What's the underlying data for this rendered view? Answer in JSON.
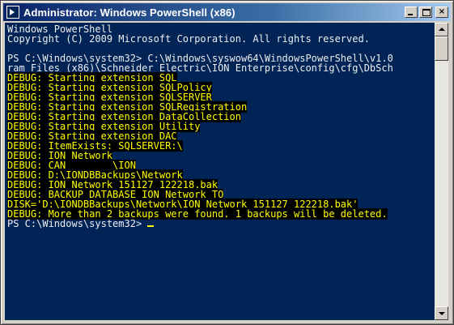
{
  "window": {
    "title": "Administrator: Windows PowerShell (x86)",
    "icon": "powershell-icon",
    "controls": {
      "minimize": "minimize-icon",
      "maximize": "maximize-icon",
      "close": "×"
    }
  },
  "console": {
    "background": "#012456",
    "lines": [
      "Windows PowerShell",
      "Copyright (C) 2009 Microsoft Corporation. All rights reserved.",
      "",
      "PS C:\\Windows\\system32> C:\\Windows\\syswow64\\WindowsPowerShell\\v1.0",
      "ram Files (x86)\\Schneider Electric\\ION Enterprise\\config\\cfg\\DbSch",
      "DEBUG: Starting extension SQL",
      "DEBUG: Starting extension SQLPolicy",
      "DEBUG: Starting extension SQLSERVER",
      "DEBUG: Starting extension SQLRegistration",
      "DEBUG: Starting extension DataCollection",
      "DEBUG: Starting extension Utility",
      "DEBUG: Starting extension DAC",
      "DEBUG: ItemExists: SQLSERVER:\\",
      "DEBUG: ION_Network",
      "DEBUG: CAN________\\ION",
      "DEBUG: D:\\IONDBBackups\\Network",
      "DEBUG: ION_Network_151127_122218.bak",
      "DEBUG: BACKUP DATABASE ION_Network TO",
      "DISK='D:\\IONDBBackups\\Network\\ION_Network_151127_122218.bak'",
      "DEBUG: More than 2 backups were found. 1 backups will be deleted.",
      "PS C:\\Windows\\system32> "
    ]
  }
}
